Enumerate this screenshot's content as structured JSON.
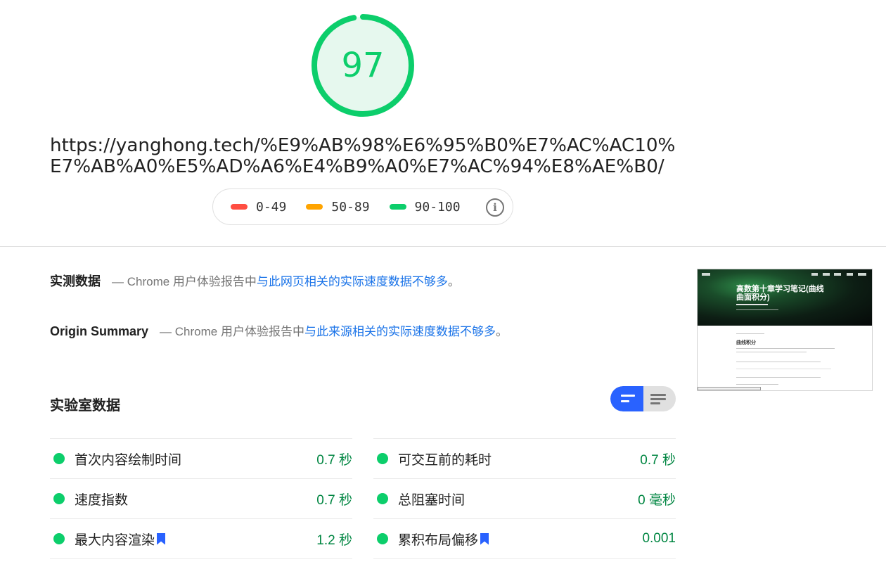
{
  "score": {
    "value": "97",
    "fraction": 0.97,
    "color": "#0cce6b",
    "track_color": "#e6f8ee"
  },
  "url": "https://yanghong.tech/%E9%AB%98%E6%95%B0%E7%AC%AC10%E7%AB%A0%E5%AD%A6%E4%B9%A0%E7%AC%94%E8%AE%B0/",
  "legend": {
    "items": [
      {
        "label": "0-49",
        "color": "#ff4e42"
      },
      {
        "label": "50-89",
        "color": "#ffa400"
      },
      {
        "label": "90-100",
        "color": "#0cce6b"
      }
    ],
    "info_icon": "info-icon"
  },
  "field_data": {
    "title": "实测数据",
    "desc_prefix": "— Chrome 用户体验报告中",
    "link_text": "与此网页相关的实际速度数据不够多",
    "desc_suffix": "。"
  },
  "origin_summary": {
    "title": "Origin Summary",
    "desc_prefix": "— Chrome 用户体验报告中",
    "link_text": "与此来源相关的实际速度数据不够多",
    "desc_suffix": "。"
  },
  "thumbnail": {
    "title": "高数第十章学习笔记(曲线曲面积分)",
    "heading": "曲线积分"
  },
  "lab_data": {
    "title": "实验室数据",
    "view_toggle": {
      "active": "summary-view",
      "options": [
        "summary-view-icon",
        "list-view-icon"
      ]
    },
    "metrics": [
      {
        "name": "首次内容绘制时间",
        "value": "0.7 秒",
        "status": "good",
        "bookmark": false
      },
      {
        "name": "可交互前的耗时",
        "value": "0.7 秒",
        "status": "good",
        "bookmark": false
      },
      {
        "name": "速度指数",
        "value": "0.7 秒",
        "status": "good",
        "bookmark": false
      },
      {
        "name": "总阻塞时间",
        "value": "0 毫秒",
        "status": "good",
        "bookmark": false
      },
      {
        "name": "最大内容渲染",
        "value": "1.2 秒",
        "status": "good",
        "bookmark": true
      },
      {
        "name": "累积布局偏移",
        "value": "0.001",
        "status": "good",
        "bookmark": true
      }
    ],
    "accent_color": "#2962ff",
    "good_color": "#0cce6b"
  }
}
